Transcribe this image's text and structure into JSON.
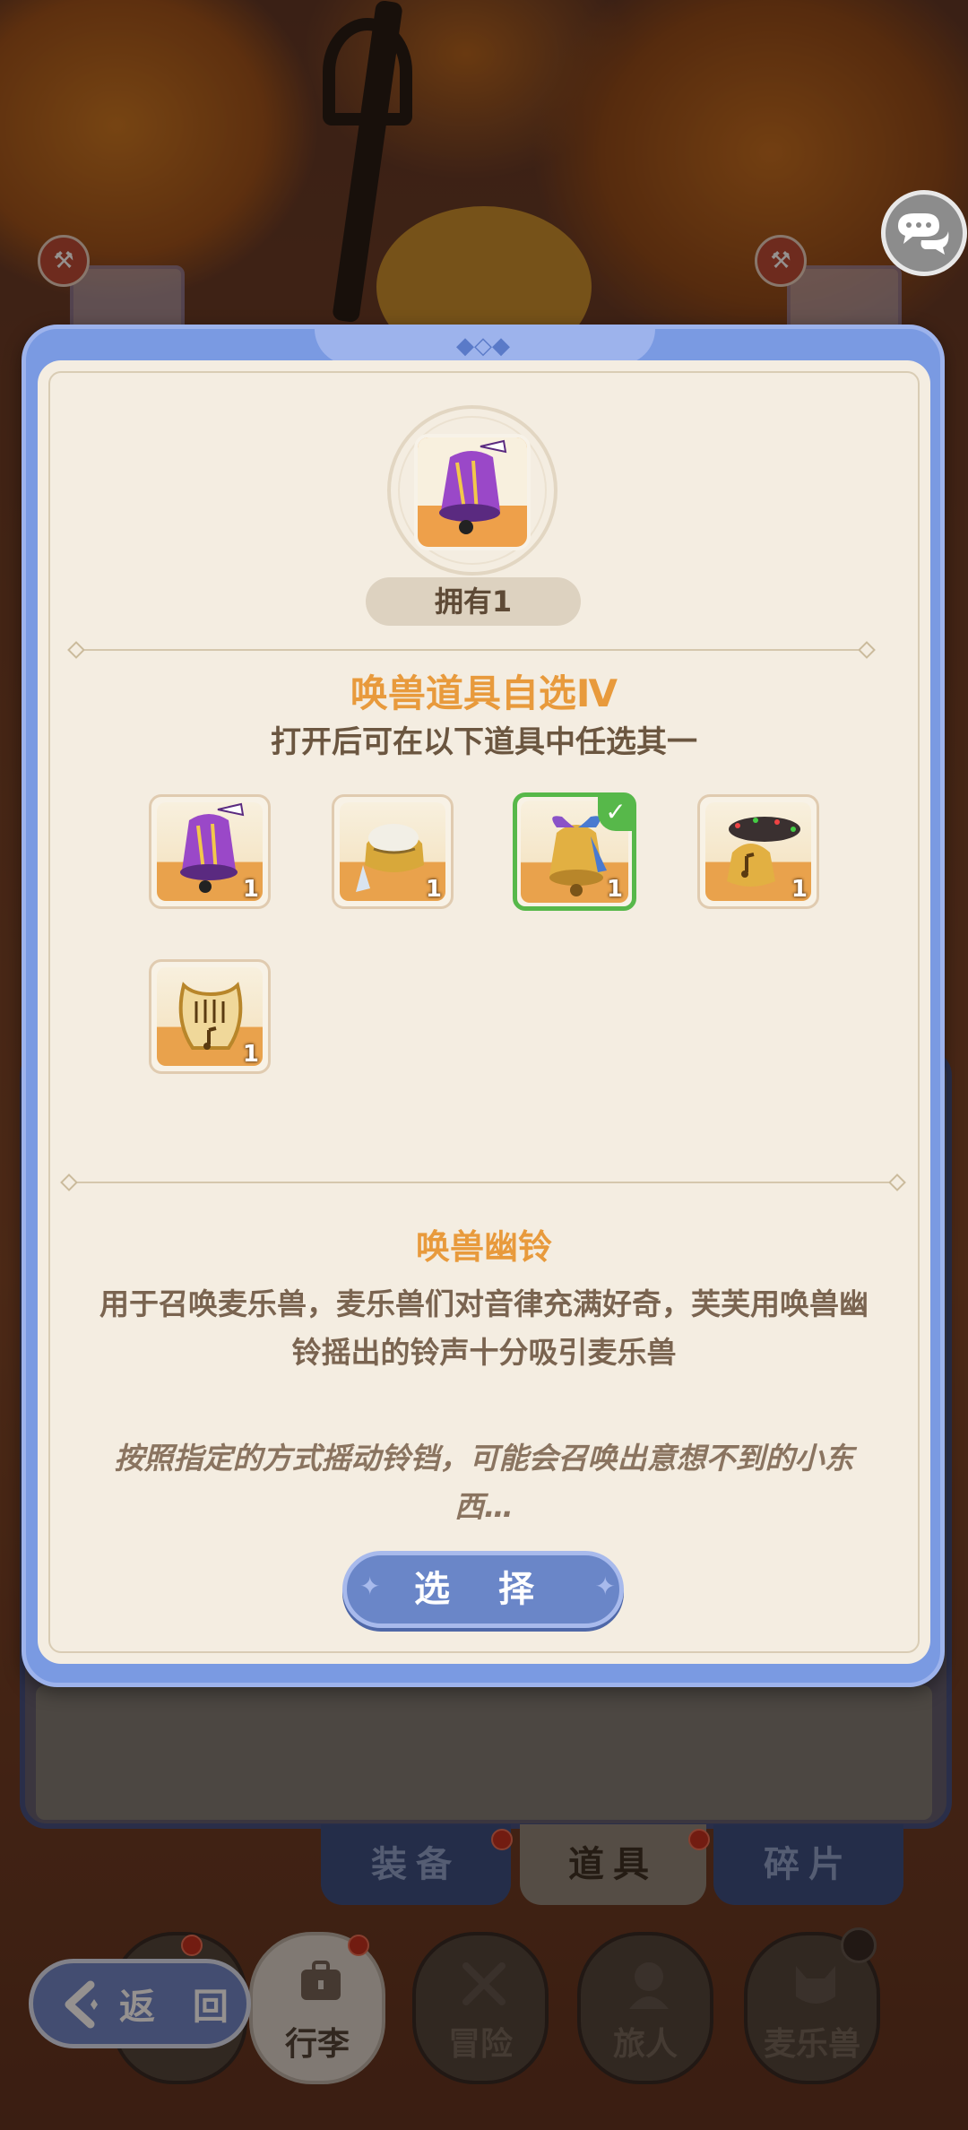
{
  "dialog": {
    "owned_label": "拥有1",
    "title": "唤兽道具自选Ⅳ",
    "subtitle": "打开后可在以下道具中任选其一",
    "options": [
      {
        "name": "purple-horn-bell",
        "count": "1",
        "selected": false
      },
      {
        "name": "gold-ornate-bell",
        "count": "1",
        "selected": false
      },
      {
        "name": "ribbon-gold-bell",
        "count": "1",
        "selected": true
      },
      {
        "name": "tambourine-bell",
        "count": "1",
        "selected": false
      },
      {
        "name": "lyre-bell",
        "count": "1",
        "selected": false
      }
    ],
    "item_name": "唤兽幽铃",
    "description": "用于召唤麦乐兽，麦乐兽们对音律充满好奇，芙芙用唤兽幽铃摇出的铃声十分吸引麦乐兽",
    "flavor_text": "按照指定的方式摇动铃铛，可能会召唤出意想不到的小东西…",
    "select_label": "选 择"
  },
  "tabs": [
    {
      "label": "装备",
      "active": false
    },
    {
      "label": "道具",
      "active": true
    },
    {
      "label": "碎片",
      "active": false
    }
  ],
  "nav": [
    {
      "label": "行李",
      "active": true
    },
    {
      "label": "冒险",
      "active": false
    },
    {
      "label": "旅人",
      "active": false
    },
    {
      "label": "麦乐兽",
      "active": false
    }
  ],
  "back_label": "返 回",
  "colors": {
    "accent_orange": "#e89a3c",
    "dialog_blue": "#7a9ae2",
    "paper": "#f4ede1",
    "selected_green": "#57b84a"
  }
}
